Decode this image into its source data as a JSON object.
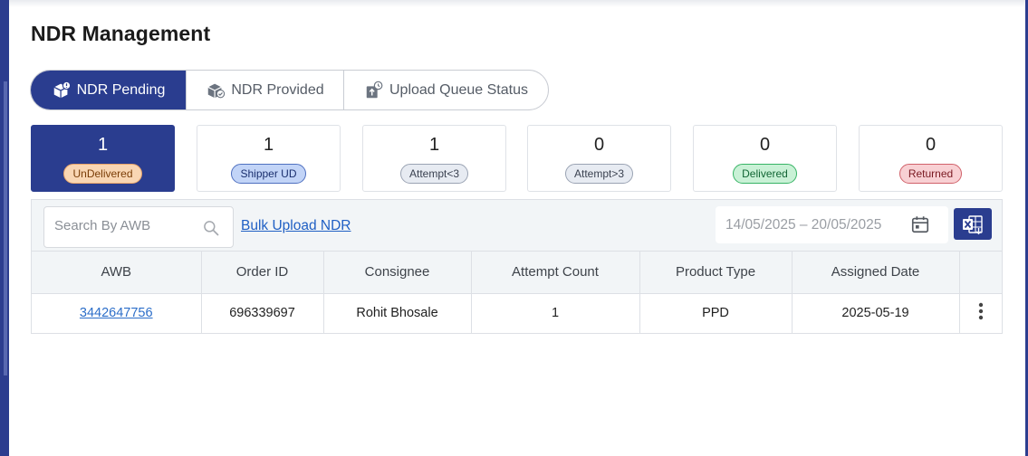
{
  "page": {
    "title": "NDR Management"
  },
  "tabs": [
    {
      "label": "NDR Pending",
      "icon": "box-alert-icon",
      "active": true
    },
    {
      "label": "NDR Provided",
      "icon": "box-check-icon",
      "active": false
    },
    {
      "label": "Upload Queue Status",
      "icon": "upload-clock-icon",
      "active": false
    }
  ],
  "status_cards": [
    {
      "count": "1",
      "label": "UnDelivered",
      "active": true
    },
    {
      "count": "1",
      "label": "Shipper UD",
      "active": false
    },
    {
      "count": "1",
      "label": "Attempt<3",
      "active": false
    },
    {
      "count": "0",
      "label": "Attempt>3",
      "active": false
    },
    {
      "count": "0",
      "label": "Delivered",
      "active": false
    },
    {
      "count": "0",
      "label": "Returned",
      "active": false
    }
  ],
  "toolbar": {
    "search_placeholder": "Search By AWB",
    "bulk_upload_label": "Bulk Upload NDR",
    "date_range": "14/05/2025 – 20/05/2025",
    "export_icon": "excel-export-icon"
  },
  "table": {
    "columns": [
      "AWB",
      "Order ID",
      "Consignee",
      "Attempt Count",
      "Product Type",
      "Assigned Date"
    ],
    "rows": [
      {
        "awb": "3442647756",
        "order_id": "696339697",
        "consignee": "Rohit Bhosale",
        "attempt_count": "1",
        "product_type": "PPD",
        "assigned_date": "2025-05-19"
      }
    ]
  },
  "colors": {
    "primary": "#2a3d8f",
    "link": "#1f5fc4",
    "undelivered_badge": "#f9d6b3",
    "shipper_ud_badge": "#c2d4f7",
    "delivered_badge": "#c9f1d6",
    "returned_badge": "#f8d0d3"
  }
}
